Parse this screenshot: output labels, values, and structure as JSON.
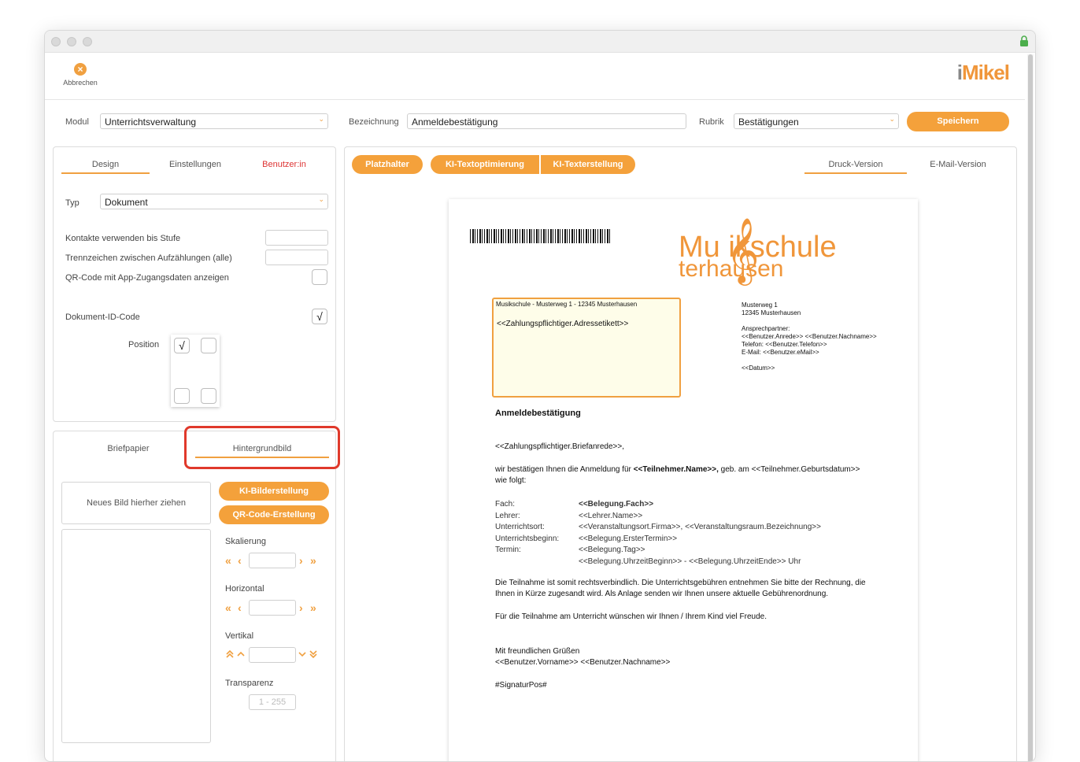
{
  "toolbar": {
    "cancel_label": "Abbrechen",
    "logo_i": "i",
    "logo_text": "Mikel"
  },
  "top": {
    "modul_label": "Modul",
    "modul_value": "Unterrichtsverwaltung",
    "bezeichnung_label": "Bezeichnung",
    "bezeichnung_value": "Anmeldebestätigung",
    "rubrik_label": "Rubrik",
    "rubrik_value": "Bestätigungen",
    "save_label": "Speichern"
  },
  "left_panel": {
    "tabs": [
      "Design",
      "Einstellungen",
      "Benutzer:in"
    ],
    "typ_label": "Typ",
    "typ_value": "Dokument",
    "rows": [
      "Kontakte verwenden bis Stufe",
      "Trennzeichen zwischen Aufzählungen (alle)",
      "QR-Code mit App-Zugangsdaten anzeigen",
      "Dokument-ID-Code"
    ],
    "checkmark": "√",
    "position_label": "Position"
  },
  "lower_panel": {
    "tabs": [
      "Briefpapier",
      "Hintergrundbild"
    ],
    "drop_text": "Neues Bild hierher ziehen",
    "ki_button": "KI-Bilderstellung",
    "qr_button": "QR-Code-Erstellung",
    "skalierung": "Skalierung",
    "horizontal": "Horizontal",
    "vertikal": "Vertikal",
    "transparenz": "Transparenz",
    "transparenz_placeholder": "1 - 255"
  },
  "right_panel": {
    "buttons": [
      "Platzhalter",
      "KI-Textoptimierung",
      "KI-Texterstellung"
    ],
    "tabs": [
      "Druck-Version",
      "E-Mail-Version"
    ]
  },
  "document": {
    "brand_line1": "Mu  ikschule",
    "brand_line2": "   terhausen",
    "sender_line": "Musikschule - Musterweg 1 - 12345 Musterhausen",
    "address_placeholder": "<<Zahlungspflichtiger.Adressetikett>>",
    "right_block": [
      "Musterweg 1",
      "12345 Musterhausen",
      "",
      "Ansprechpartner:",
      "<<Benutzer.Anrede>> <<Benutzer.Nachname>>",
      "Telefon: <<Benutzer.Telefon>>",
      "E-Mail: <<Benutzer.eMail>>",
      "",
      "<<Datum>>"
    ],
    "subject": "Anmeldebestätigung",
    "salutation": "<<Zahlungspflichtiger.Briefanrede>>,",
    "intro_pre": "wir bestätigen Ihnen die Anmeldung für ",
    "intro_bold": "<<Teilnehmer.Name>>,",
    "intro_post": " geb. am <<Teilnehmer.Geburtsdatum>>",
    "intro_line2": "wie folgt:",
    "details": [
      {
        "key": "Fach:",
        "value": "<<Belegung.Fach>>",
        "bold": true
      },
      {
        "key": "Lehrer:",
        "value": "<<Lehrer.Name>>"
      },
      {
        "key": "Unterrichtsort:",
        "value": "<<Veranstaltungsort.Firma>>, <<Veranstaltungsraum.Bezeichnung>>"
      },
      {
        "key": "Unterrichtsbeginn:",
        "value": "<<Belegung.ErsterTermin>>"
      },
      {
        "key": "Termin:",
        "value": "<<Belegung.Tag>>"
      },
      {
        "key": "",
        "value": "<<Belegung.UhrzeitBeginn>> - <<Belegung.UhrzeitEnde>> Uhr"
      }
    ],
    "para1_l1": "Die Teilnahme ist somit rechtsverbindlich. Die Unterrichtsgebühren entnehmen Sie bitte der Rechnung, die",
    "para1_l2": "Ihnen in Kürze zugesandt wird. Als Anlage senden wir Ihnen unsere aktuelle Gebührenordnung.",
    "para2": "Für die Teilnahme am Unterricht wünschen wir Ihnen / Ihrem Kind viel Freude.",
    "closing": "Mit freundlichen Grüßen",
    "signature": "<<Benutzer.Vorname>> <<Benutzer.Nachname>>",
    "signature_pos": "#SignaturPos#"
  },
  "colors": {
    "accent": "#f4a13b",
    "highlight": "#e0392b"
  }
}
